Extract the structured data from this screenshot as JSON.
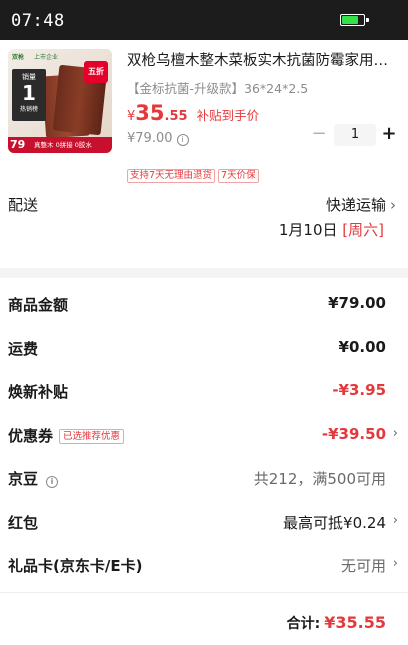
{
  "status_bar": {
    "time": "07:48",
    "battery_level": 0.8,
    "battery_color": "#35e04a"
  },
  "product": {
    "title": "双枪乌檀木整木菜板实木抗菌防霉家用切菜板",
    "spec": "【金标抗菌-升级款】36*24*2.5",
    "price_symbol": "¥",
    "price_int": "35",
    "price_dec": ".55",
    "subsidy_note": "补贴到手价",
    "original_price": "¥79.00",
    "quantity": "1",
    "tags": [
      "支持7天无理由退货",
      "7天价保"
    ],
    "thumbnail": {
      "brand": "双枪",
      "brand_sub": "上市企业",
      "sale_badge": "五折",
      "top_line1": "销量",
      "top_rank": "TOP 1",
      "top_line3": "热销榜",
      "banner_price": "79",
      "banner_text": "真整木 0拼接 0胶水"
    }
  },
  "delivery": {
    "label": "配送",
    "method": "快递运输",
    "date": "1月10日",
    "weekday": "[周六]"
  },
  "summary": {
    "goods_amount": {
      "label": "商品金额",
      "value": "¥79.00"
    },
    "shipping": {
      "label": "运费",
      "value": "¥0.00"
    },
    "trade_in_subsidy": {
      "label": "焕新补贴",
      "value": "-¥3.95"
    },
    "coupon": {
      "label": "优惠券",
      "tag": "已选推荐优惠",
      "value": "-¥39.50"
    },
    "jingdou": {
      "label": "京豆",
      "value": "共212，满500可用"
    },
    "red_packet": {
      "label": "红包",
      "value": "最高可抵¥0.24"
    },
    "gift_card": {
      "label": "礼品卡(京东卡/E卡)",
      "value": "无可用"
    }
  },
  "total": {
    "label": "合计:",
    "value": "¥35.55"
  },
  "colors": {
    "accent_red": "#e4393c",
    "muted_text": "#8c8c8c",
    "divider": "#f4f4f4"
  }
}
